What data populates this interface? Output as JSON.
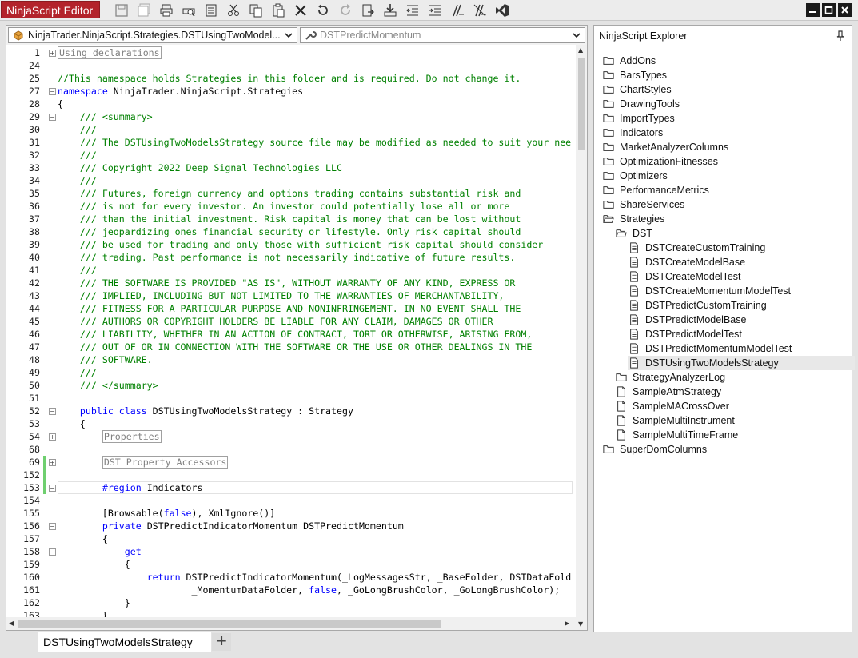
{
  "app": {
    "title": "NinjaScript Editor"
  },
  "toolbar": {
    "buttons": [
      "save-icon",
      "save-all-icon",
      "print-icon",
      "print-preview-icon",
      "properties-icon",
      "cut-icon",
      "copy-icon",
      "paste-icon",
      "delete-icon",
      "undo-icon",
      "redo-icon",
      "compile-icon",
      "import-icon",
      "outdent-icon",
      "indent-icon",
      "comment-icon",
      "uncomment-icon",
      "visual-studio-icon"
    ]
  },
  "editor": {
    "class_dropdown": "NinjaTrader.NinjaScript.Strategies.DSTUsingTwoModel...",
    "member_dropdown": "DSTPredictMomentum",
    "lines": [
      {
        "n": "1",
        "parts": [
          {
            "t": "Using declarations",
            "c": "boxed"
          }
        ],
        "fold": "+"
      },
      {
        "n": "24",
        "parts": []
      },
      {
        "n": "25",
        "parts": [
          {
            "t": "//This namespace holds Strategies in this folder and is required. Do not change it.",
            "c": "cmt"
          }
        ]
      },
      {
        "n": "27",
        "parts": [
          {
            "t": "namespace",
            "c": "kw"
          },
          {
            "t": " NinjaTrader.NinjaScript.Strategies",
            "c": ""
          }
        ],
        "fold": "-"
      },
      {
        "n": "28",
        "parts": [
          {
            "t": "{",
            "c": ""
          }
        ]
      },
      {
        "n": "29",
        "parts": [
          {
            "t": "    /// <summary>",
            "c": "cmt"
          }
        ],
        "fold": "-"
      },
      {
        "n": "30",
        "parts": [
          {
            "t": "    ///",
            "c": "cmt"
          }
        ]
      },
      {
        "n": "31",
        "parts": [
          {
            "t": "    /// The DSTUsingTwoModelsStrategy source file may be modified as needed to suit your nee",
            "c": "cmt"
          }
        ]
      },
      {
        "n": "32",
        "parts": [
          {
            "t": "    ///",
            "c": "cmt"
          }
        ]
      },
      {
        "n": "33",
        "parts": [
          {
            "t": "    /// Copyright 2022 Deep Signal Technologies LLC",
            "c": "cmt"
          }
        ]
      },
      {
        "n": "34",
        "parts": [
          {
            "t": "    ///",
            "c": "cmt"
          }
        ]
      },
      {
        "n": "35",
        "parts": [
          {
            "t": "    /// Futures, foreign currency and options trading contains substantial risk and",
            "c": "cmt"
          }
        ]
      },
      {
        "n": "36",
        "parts": [
          {
            "t": "    /// is not for every investor. An investor could potentially lose all or more",
            "c": "cmt"
          }
        ]
      },
      {
        "n": "37",
        "parts": [
          {
            "t": "    /// than the initial investment. Risk capital is money that can be lost without",
            "c": "cmt"
          }
        ]
      },
      {
        "n": "38",
        "parts": [
          {
            "t": "    /// jeopardizing ones financial security or lifestyle. Only risk capital should",
            "c": "cmt"
          }
        ]
      },
      {
        "n": "39",
        "parts": [
          {
            "t": "    /// be used for trading and only those with sufficient risk capital should consider",
            "c": "cmt"
          }
        ]
      },
      {
        "n": "40",
        "parts": [
          {
            "t": "    /// trading. Past performance is not necessarily indicative of future results.",
            "c": "cmt"
          }
        ]
      },
      {
        "n": "41",
        "parts": [
          {
            "t": "    ///",
            "c": "cmt"
          }
        ]
      },
      {
        "n": "42",
        "parts": [
          {
            "t": "    /// THE SOFTWARE IS PROVIDED \"AS IS\", WITHOUT WARRANTY OF ANY KIND, EXPRESS OR",
            "c": "cmt"
          }
        ]
      },
      {
        "n": "43",
        "parts": [
          {
            "t": "    /// IMPLIED, INCLUDING BUT NOT LIMITED TO THE WARRANTIES OF MERCHANTABILITY,",
            "c": "cmt"
          }
        ]
      },
      {
        "n": "44",
        "parts": [
          {
            "t": "    /// FITNESS FOR A PARTICULAR PURPOSE AND NONINFRINGEMENT. IN NO EVENT SHALL THE",
            "c": "cmt"
          }
        ]
      },
      {
        "n": "45",
        "parts": [
          {
            "t": "    /// AUTHORS OR COPYRIGHT HOLDERS BE LIABLE FOR ANY CLAIM, DAMAGES OR OTHER",
            "c": "cmt"
          }
        ]
      },
      {
        "n": "46",
        "parts": [
          {
            "t": "    /// LIABILITY, WHETHER IN AN ACTION OF CONTRACT, TORT OR OTHERWISE, ARISING FROM,",
            "c": "cmt"
          }
        ]
      },
      {
        "n": "47",
        "parts": [
          {
            "t": "    /// OUT OF OR IN CONNECTION WITH THE SOFTWARE OR THE USE OR OTHER DEALINGS IN THE",
            "c": "cmt"
          }
        ]
      },
      {
        "n": "48",
        "parts": [
          {
            "t": "    /// SOFTWARE.",
            "c": "cmt"
          }
        ]
      },
      {
        "n": "49",
        "parts": [
          {
            "t": "    ///",
            "c": "cmt"
          }
        ]
      },
      {
        "n": "50",
        "parts": [
          {
            "t": "    /// </summary>",
            "c": "cmt"
          }
        ]
      },
      {
        "n": "51",
        "parts": []
      },
      {
        "n": "52",
        "parts": [
          {
            "t": "    ",
            "c": ""
          },
          {
            "t": "public class",
            "c": "kw"
          },
          {
            "t": " DSTUsingTwoModelsStrategy : Strategy",
            "c": ""
          }
        ],
        "fold": "-"
      },
      {
        "n": "53",
        "parts": [
          {
            "t": "    {",
            "c": ""
          }
        ]
      },
      {
        "n": "54",
        "parts": [
          {
            "t": "        ",
            "c": ""
          },
          {
            "t": "Properties",
            "c": "boxed"
          }
        ],
        "fold": "+"
      },
      {
        "n": "68",
        "parts": []
      },
      {
        "n": "69",
        "parts": [
          {
            "t": "        ",
            "c": ""
          },
          {
            "t": "DST Property Accessors",
            "c": "boxed"
          }
        ],
        "fold": "+",
        "marker": true
      },
      {
        "n": "152",
        "parts": [],
        "marker": true
      },
      {
        "n": "153",
        "parts": [
          {
            "t": "        ",
            "c": ""
          },
          {
            "t": "#region",
            "c": "kw"
          },
          {
            "t": " Indicators",
            "c": ""
          }
        ],
        "fold": "-",
        "marker": true,
        "current": true
      },
      {
        "n": "154",
        "parts": []
      },
      {
        "n": "155",
        "parts": [
          {
            "t": "        [Browsable(",
            "c": ""
          },
          {
            "t": "false",
            "c": "kw"
          },
          {
            "t": "), XmlIgnore()]",
            "c": ""
          }
        ]
      },
      {
        "n": "156",
        "parts": [
          {
            "t": "        ",
            "c": ""
          },
          {
            "t": "private",
            "c": "kw"
          },
          {
            "t": " DSTPredictIndicatorMomentum DSTPredictMomentum",
            "c": ""
          }
        ],
        "fold": "-"
      },
      {
        "n": "157",
        "parts": [
          {
            "t": "        {",
            "c": ""
          }
        ]
      },
      {
        "n": "158",
        "parts": [
          {
            "t": "            ",
            "c": ""
          },
          {
            "t": "get",
            "c": "kw"
          }
        ],
        "fold": "-"
      },
      {
        "n": "159",
        "parts": [
          {
            "t": "            {",
            "c": ""
          }
        ]
      },
      {
        "n": "160",
        "parts": [
          {
            "t": "                ",
            "c": ""
          },
          {
            "t": "return",
            "c": "kw"
          },
          {
            "t": " DSTPredictIndicatorMomentum(_LogMessagesStr, _BaseFolder, DSTDataFold",
            "c": ""
          }
        ]
      },
      {
        "n": "161",
        "parts": [
          {
            "t": "                        _MomentumDataFolder, ",
            "c": ""
          },
          {
            "t": "false",
            "c": "kw"
          },
          {
            "t": ", _GoLongBrushColor, _GoLongBrushColor);",
            "c": ""
          }
        ]
      },
      {
        "n": "162",
        "parts": [
          {
            "t": "            }",
            "c": ""
          }
        ]
      },
      {
        "n": "163",
        "parts": [
          {
            "t": "        }",
            "c": ""
          }
        ]
      }
    ]
  },
  "tabs": {
    "active": "DSTUsingTwoModelsStrategy",
    "add_label": "+"
  },
  "explorer": {
    "title": "NinjaScript Explorer",
    "items": [
      {
        "label": "AddOns",
        "type": "folder",
        "level": 0
      },
      {
        "label": "BarsTypes",
        "type": "folder",
        "level": 0
      },
      {
        "label": "ChartStyles",
        "type": "folder",
        "level": 0
      },
      {
        "label": "DrawingTools",
        "type": "folder",
        "level": 0
      },
      {
        "label": "ImportTypes",
        "type": "folder",
        "level": 0
      },
      {
        "label": "Indicators",
        "type": "folder",
        "level": 0
      },
      {
        "label": "MarketAnalyzerColumns",
        "type": "folder",
        "level": 0
      },
      {
        "label": "OptimizationFitnesses",
        "type": "folder",
        "level": 0
      },
      {
        "label": "Optimizers",
        "type": "folder",
        "level": 0
      },
      {
        "label": "PerformanceMetrics",
        "type": "folder",
        "level": 0
      },
      {
        "label": "ShareServices",
        "type": "folder",
        "level": 0
      },
      {
        "label": "Strategies",
        "type": "folder-open",
        "level": 0
      },
      {
        "label": "DST",
        "type": "folder-open",
        "level": 1
      },
      {
        "label": "DSTCreateCustomTraining",
        "type": "file",
        "level": 2
      },
      {
        "label": "DSTCreateModelBase",
        "type": "file",
        "level": 2
      },
      {
        "label": "DSTCreateModelTest",
        "type": "file",
        "level": 2
      },
      {
        "label": "DSTCreateMomentumModelTest",
        "type": "file",
        "level": 2
      },
      {
        "label": "DSTPredictCustomTraining",
        "type": "file",
        "level": 2
      },
      {
        "label": "DSTPredictModelBase",
        "type": "file",
        "level": 2
      },
      {
        "label": "DSTPredictModelTest",
        "type": "file",
        "level": 2
      },
      {
        "label": "DSTPredictMomentumModelTest",
        "type": "file",
        "level": 2
      },
      {
        "label": "DSTUsingTwoModelsStrategy",
        "type": "file",
        "level": 2,
        "selected": true
      },
      {
        "label": "StrategyAnalyzerLog",
        "type": "folder",
        "level": 1
      },
      {
        "label": "SampleAtmStrategy",
        "type": "file",
        "level": 1
      },
      {
        "label": "SampleMACrossOver",
        "type": "file",
        "level": 1
      },
      {
        "label": "SampleMultiInstrument",
        "type": "file",
        "level": 1
      },
      {
        "label": "SampleMultiTimeFrame",
        "type": "file",
        "level": 1
      },
      {
        "label": "SuperDomColumns",
        "type": "folder",
        "level": 0
      }
    ]
  }
}
